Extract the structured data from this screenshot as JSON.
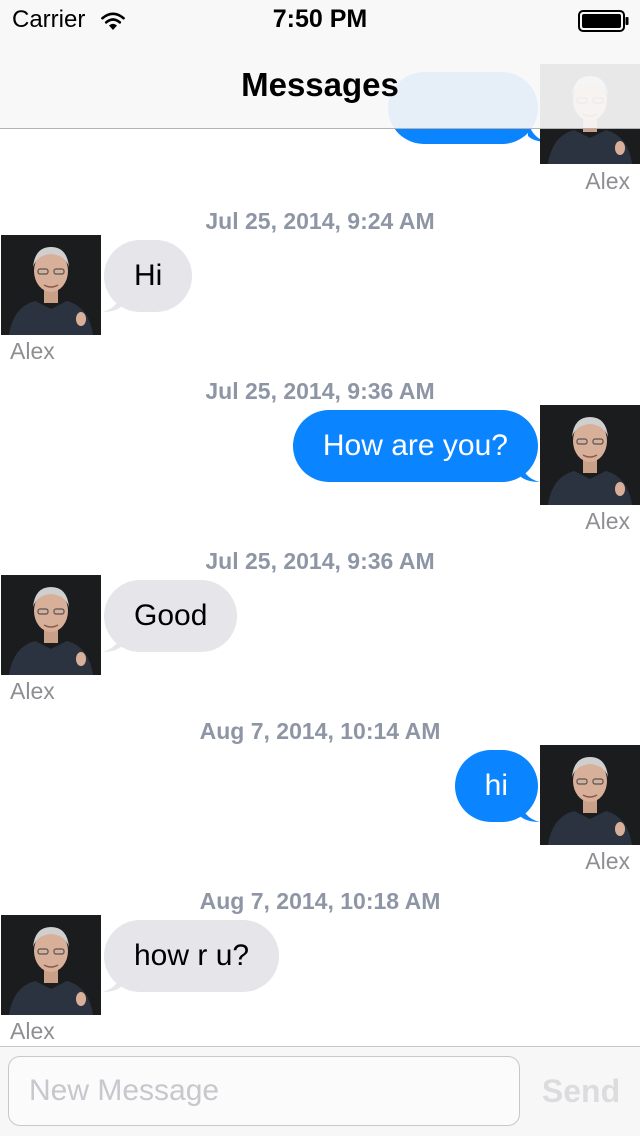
{
  "status_bar": {
    "carrier": "Carrier",
    "time": "7:50 PM",
    "wifi_icon": "wifi-icon",
    "battery_icon": "battery-full-icon"
  },
  "nav": {
    "title": "Messages"
  },
  "messages": [
    {
      "direction": "outgoing",
      "text": "",
      "sender": "Alex",
      "partial": true
    },
    {
      "timestamp": "Jul 25, 2014, 9:24 AM",
      "direction": "incoming",
      "text": "Hi",
      "sender": "Alex"
    },
    {
      "timestamp": "Jul 25, 2014, 9:36 AM",
      "direction": "outgoing",
      "text": "How are you?",
      "sender": "Alex"
    },
    {
      "timestamp": "Jul 25, 2014, 9:36 AM",
      "direction": "incoming",
      "text": "Good",
      "sender": "Alex"
    },
    {
      "timestamp": "Aug 7, 2014, 10:14 AM",
      "direction": "outgoing",
      "text": "hi",
      "sender": "Alex"
    },
    {
      "timestamp": "Aug 7, 2014, 10:18 AM",
      "direction": "incoming",
      "text": "how r u?",
      "sender": "Alex"
    }
  ],
  "input": {
    "placeholder": "New Message",
    "value": ""
  },
  "send_label": "Send",
  "colors": {
    "outgoing_bubble": "#0a84ff",
    "incoming_bubble": "#e5e5ea",
    "timestamp": "#8e96a6",
    "sender_name": "#8e8e93",
    "send_disabled": "#dcdcdf"
  }
}
